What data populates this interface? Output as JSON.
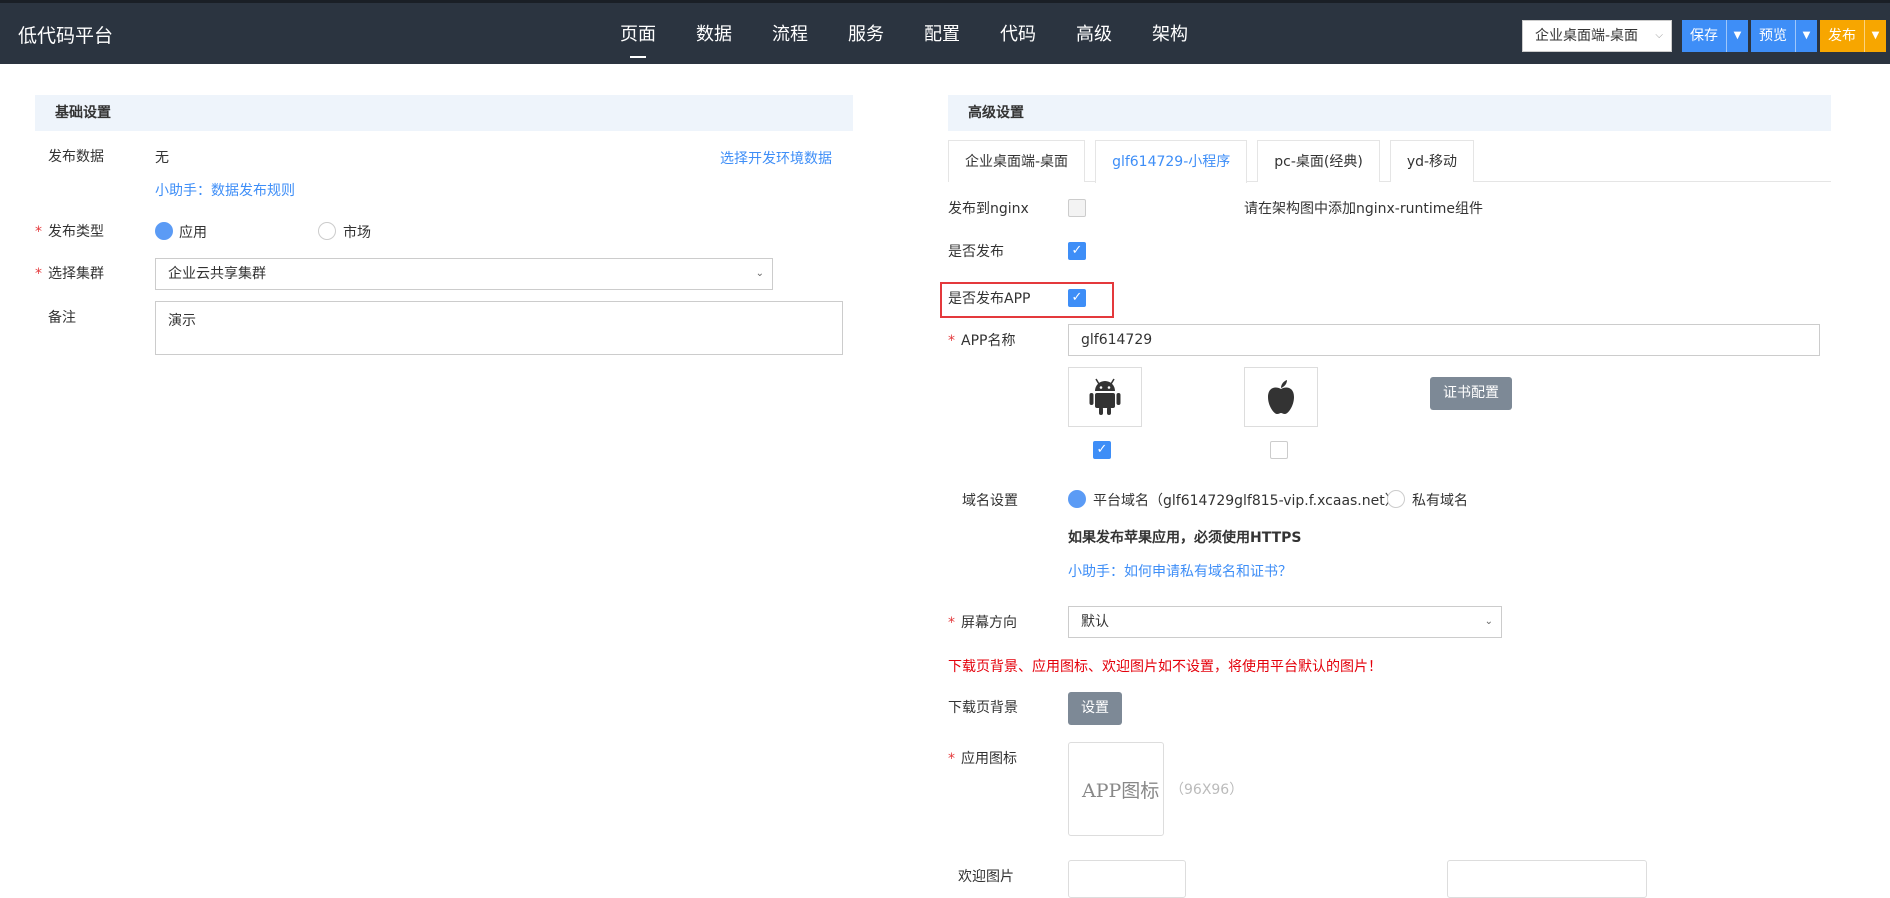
{
  "header": {
    "brand": "低代码平台",
    "nav": [
      "页面",
      "数据",
      "流程",
      "服务",
      "配置",
      "代码",
      "高级",
      "架构"
    ],
    "env_select": "企业桌面端-桌面",
    "save": "保存",
    "preview": "预览",
    "publish": "发布"
  },
  "basic": {
    "title": "基础设置",
    "publish_data_label": "发布数据",
    "publish_data_value": "无",
    "choose_env_link": "选择开发环境数据",
    "helper_link": "小助手：数据发布规则",
    "publish_type_label": "发布类型",
    "type_app": "应用",
    "type_market": "市场",
    "cluster_label": "选择集群",
    "cluster_value": "企业云共享集群",
    "remark_label": "备注",
    "remark_value": "演示"
  },
  "advanced": {
    "title": "高级设置",
    "tabs": [
      "企业桌面端-桌面",
      "glf614729-小程序",
      "pc-桌面(经典)",
      "yd-移动"
    ],
    "nginx_label": "发布到nginx",
    "nginx_hint": "请在架构图中添加nginx-runtime组件",
    "publish_label": "是否发布",
    "publish_app_label": "是否发布APP",
    "app_name_label": "APP名称",
    "app_name_value": "glf614729",
    "cert_btn": "证书配置",
    "domain_label": "域名设置",
    "platform_domain": "平台域名（glf614729glf815-vip.f.xcaas.net）",
    "private_domain": "私有域名",
    "https_note": "如果发布苹果应用，必须使用HTTPS",
    "helper_domain": "小助手：如何申请私有域名和证书？",
    "orientation_label": "屏幕方向",
    "orientation_value": "默认",
    "warn_text": "下载页背景、应用图标、欢迎图片如不设置，将使用平台默认的图片！",
    "download_bg_label": "下载页背景",
    "set_btn": "设置",
    "app_icon_label": "应用图标",
    "app_icon_text": "APP图标",
    "app_icon_size": "（96X96）",
    "welcome_label": "欢迎图片"
  },
  "check_symbol": "✓"
}
